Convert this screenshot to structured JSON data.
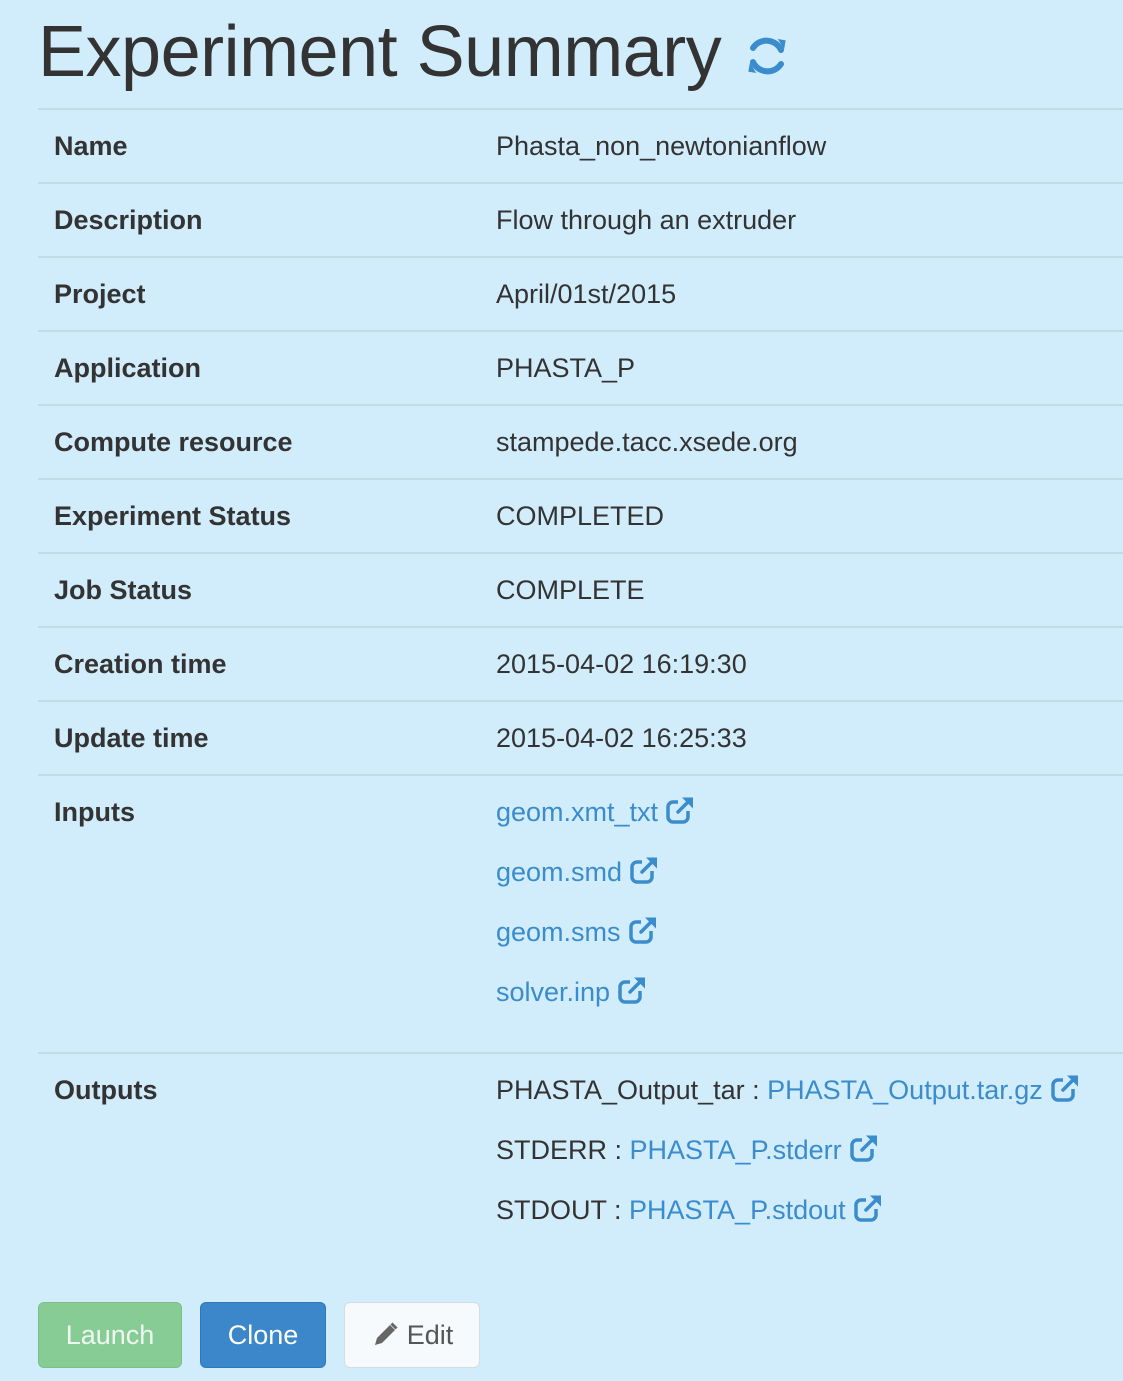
{
  "header": {
    "title": "Experiment Summary",
    "refresh_icon": "refresh-icon"
  },
  "summary": {
    "name_label": "Name",
    "name_value": "Phasta_non_newtonianflow",
    "description_label": "Description",
    "description_value": "Flow through an extruder",
    "project_label": "Project",
    "project_value": "April/01st/2015",
    "application_label": "Application",
    "application_value": "PHASTA_P",
    "compute_label": "Compute resource",
    "compute_value": "stampede.tacc.xsede.org",
    "exp_status_label": "Experiment Status",
    "exp_status_value": "COMPLETED",
    "job_status_label": "Job Status",
    "job_status_value": "COMPLETE",
    "creation_label": "Creation time",
    "creation_value": "2015-04-02 16:19:30",
    "update_label": "Update time",
    "update_value": "2015-04-02 16:25:33",
    "inputs_label": "Inputs",
    "inputs": [
      "geom.xmt_txt",
      "geom.smd",
      "geom.sms",
      "solver.inp"
    ],
    "outputs_label": "Outputs",
    "outputs": [
      {
        "name": "PHASTA_Output_tar :",
        "file": "PHASTA_Output.tar.gz"
      },
      {
        "name": "STDERR :",
        "file": "PHASTA_P.stderr"
      },
      {
        "name": "STDOUT :",
        "file": "PHASTA_P.stdout"
      }
    ]
  },
  "buttons": {
    "launch": "Launch",
    "clone": "Clone",
    "edit": "Edit"
  },
  "colors": {
    "background": "#d1ecfa",
    "link": "#3a8ccd",
    "launch": "#88cc95",
    "clone": "#3b87c9"
  }
}
